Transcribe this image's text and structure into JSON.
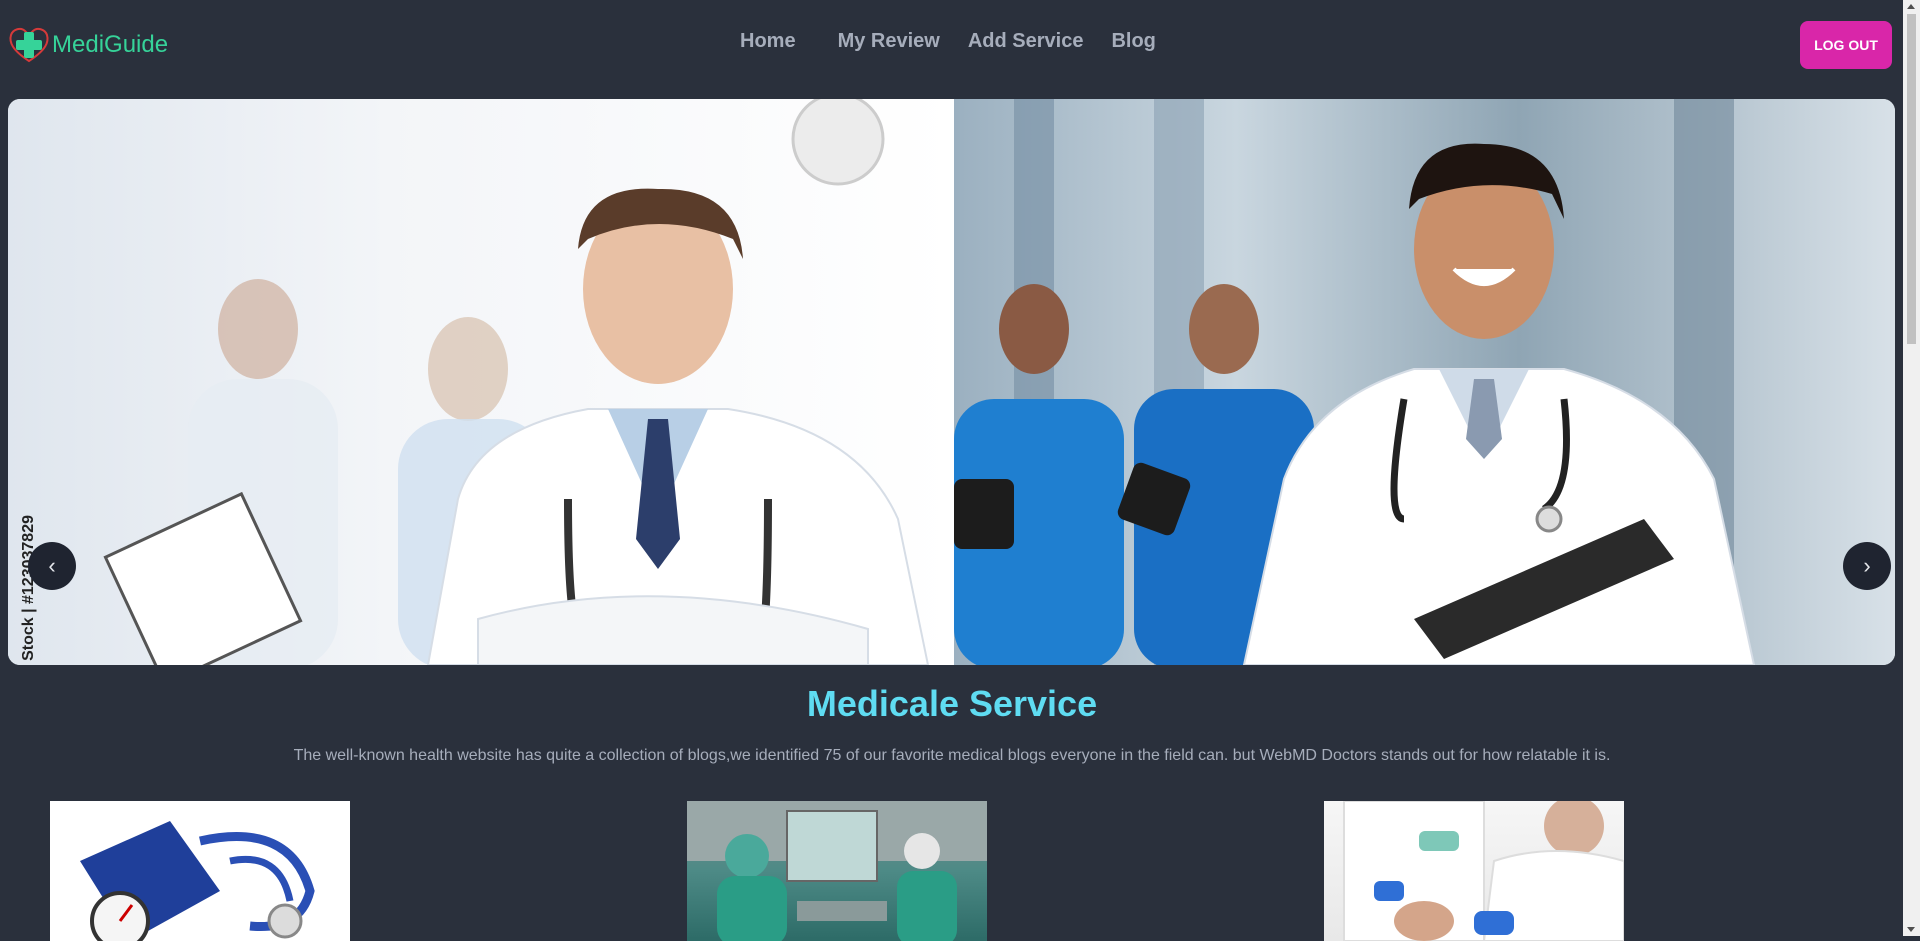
{
  "brand": {
    "name": "MediGuide",
    "logo_icon": "heart-cross-icon",
    "color": "#36d399"
  },
  "nav": {
    "items": [
      {
        "label": "Home"
      },
      {
        "label": "My Review"
      },
      {
        "label": "Add Service"
      },
      {
        "label": "Blog"
      }
    ],
    "logout_label": "LOG OUT"
  },
  "hero": {
    "watermark": "Stock | #123037829",
    "prev_label": "‹",
    "next_label": "›"
  },
  "services": {
    "title": "Medicale Service",
    "description": "The well-known health website has quite a collection of blogs,we identified 75 of our favorite medical blogs everyone in the field can. but WebMD Doctors stands out for how relatable it is."
  },
  "colors": {
    "background": "#2a303c",
    "accent": "#d926a9",
    "title": "#5fdcf2",
    "text": "#a6adbb"
  }
}
